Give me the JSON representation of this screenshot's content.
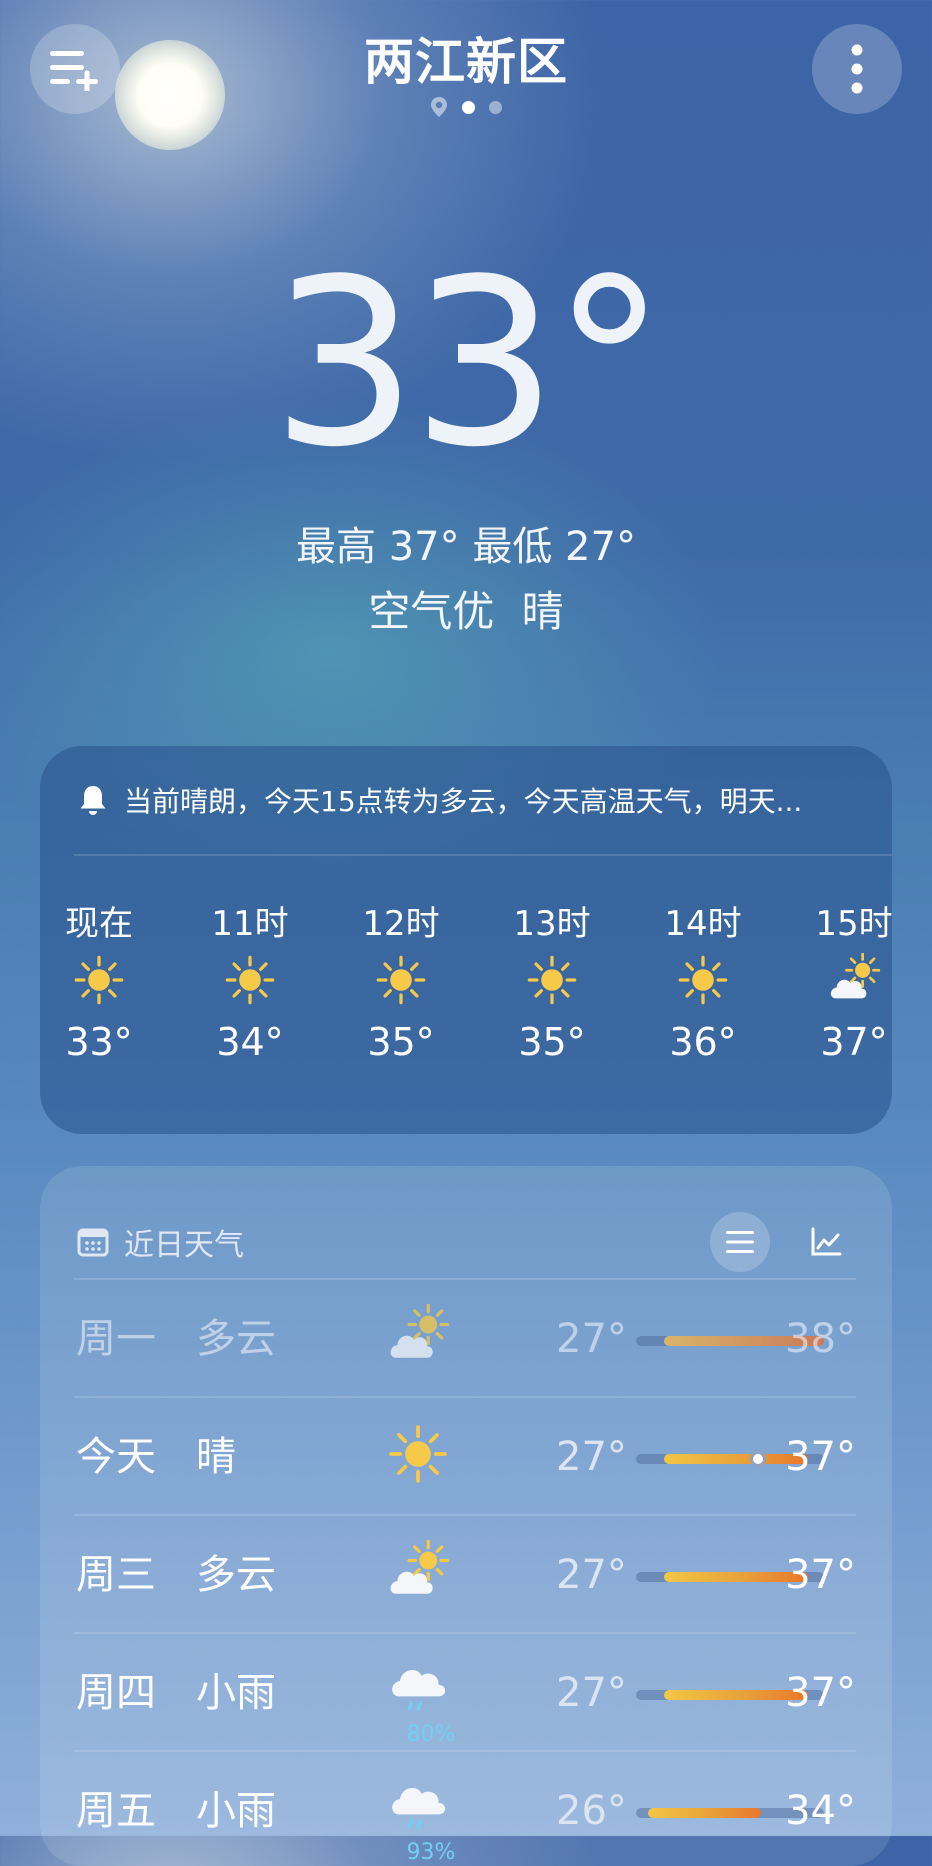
{
  "header": {
    "city": "两江新区",
    "menu_icon": "add-city-list-icon",
    "more_icon": "more-vertical-icon",
    "pages": 2,
    "active_page": 1
  },
  "current": {
    "temperature": "33°",
    "hilo": "最高 37° 最低 27°",
    "air_and_condition": "空气优 晴"
  },
  "alert": {
    "icon": "bell-icon",
    "text": "当前晴朗，今天15点转为多云，今天高温天气，明天..."
  },
  "hourly": [
    {
      "time": "现在",
      "icon": "sunny",
      "temp": "33°"
    },
    {
      "time": "11时",
      "icon": "sunny",
      "temp": "34°"
    },
    {
      "time": "12时",
      "icon": "sunny",
      "temp": "35°"
    },
    {
      "time": "13时",
      "icon": "sunny",
      "temp": "35°"
    },
    {
      "time": "14时",
      "icon": "sunny",
      "temp": "36°"
    },
    {
      "time": "15时",
      "icon": "partly-cloudy",
      "temp": "37°"
    }
  ],
  "daily": {
    "title": "近日天气",
    "calendar_icon": "calendar-icon",
    "list_view_icon": "list-view-icon",
    "chart_view_icon": "chart-view-icon",
    "scale_min": 26,
    "scale_max": 38,
    "days": [
      {
        "day": "周一",
        "cond": "多云",
        "icon": "partly-cloudy",
        "precip": "",
        "low": "27°",
        "high": "38°",
        "low_v": 27,
        "high_v": 38,
        "past": true
      },
      {
        "day": "今天",
        "cond": "晴",
        "icon": "sunny",
        "precip": "",
        "low": "27°",
        "high": "37°",
        "low_v": 27,
        "high_v": 37,
        "now_v": 33,
        "past": false
      },
      {
        "day": "周三",
        "cond": "多云",
        "icon": "partly-cloudy",
        "precip": "",
        "low": "27°",
        "high": "37°",
        "low_v": 27,
        "high_v": 37,
        "past": false
      },
      {
        "day": "周四",
        "cond": "小雨",
        "icon": "rain",
        "precip": "80%",
        "low": "27°",
        "high": "37°",
        "low_v": 27,
        "high_v": 37,
        "past": false
      },
      {
        "day": "周五",
        "cond": "小雨",
        "icon": "rain",
        "precip": "93%",
        "low": "26°",
        "high": "34°",
        "low_v": 26,
        "high_v": 34,
        "past": false
      }
    ]
  },
  "colors": {
    "sun": "#f7c948",
    "bar_warm": "#e8a13a",
    "bar_hot": "#e9772c",
    "precip": "#6fd0f2"
  }
}
